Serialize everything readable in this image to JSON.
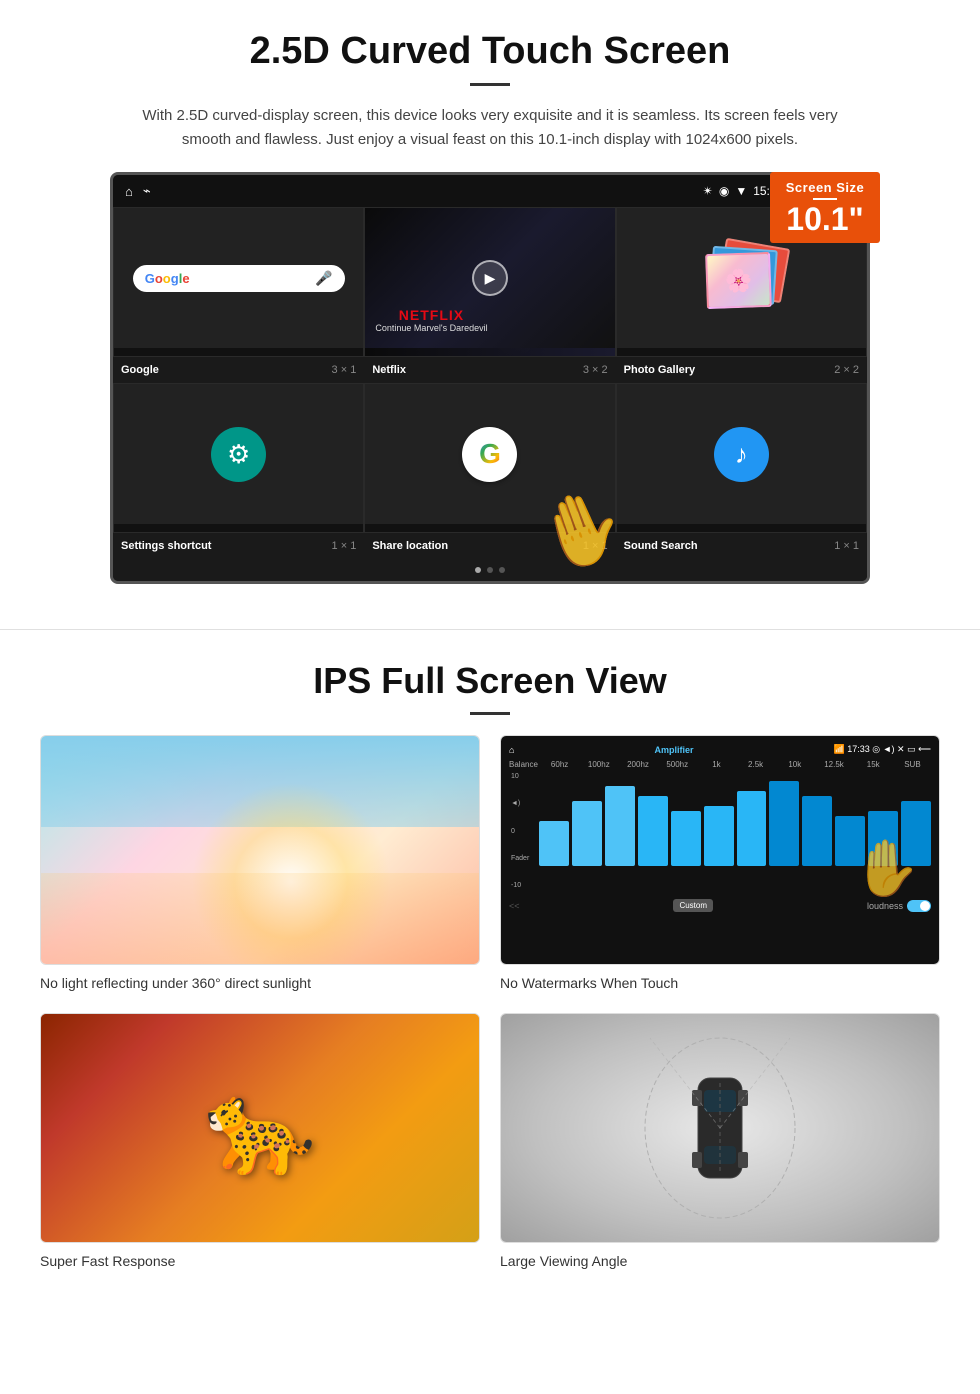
{
  "section1": {
    "title": "2.5D Curved Touch Screen",
    "description": "With 2.5D curved-display screen, this device looks very exquisite and it is seamless. Its screen feels very smooth and flawless. Just enjoy a visual feast on this 10.1-inch display with 1024x600 pixels.",
    "screen_size_badge": {
      "label": "Screen Size",
      "size": "10.1\""
    },
    "status_bar": {
      "time": "15:06"
    },
    "apps": [
      {
        "name": "Google",
        "size": "3 × 1",
        "type": "google"
      },
      {
        "name": "Netflix",
        "size": "3 × 2",
        "type": "netflix",
        "subtitle": "Continue Marvel's Daredevil"
      },
      {
        "name": "Photo Gallery",
        "size": "2 × 2",
        "type": "gallery"
      },
      {
        "name": "Settings shortcut",
        "size": "1 × 1",
        "type": "settings"
      },
      {
        "name": "Share location",
        "size": "1 × 1",
        "type": "share"
      },
      {
        "name": "Sound Search",
        "size": "1 × 1",
        "type": "sound"
      }
    ]
  },
  "section2": {
    "title": "IPS Full Screen View",
    "features": [
      {
        "id": "sunlight",
        "label": "No light reflecting under 360° direct sunlight",
        "image_type": "sky"
      },
      {
        "id": "watermark",
        "label": "No Watermarks When Touch",
        "image_type": "amplifier"
      },
      {
        "id": "response",
        "label": "Super Fast Response",
        "image_type": "cheetah"
      },
      {
        "id": "angle",
        "label": "Large Viewing Angle",
        "image_type": "car"
      }
    ]
  },
  "eq_bars": [
    45,
    65,
    80,
    70,
    55,
    60,
    75,
    85,
    70,
    50,
    55,
    65
  ],
  "icons": {
    "home": "⌂",
    "usb": "⌁",
    "bluetooth": "✴",
    "location": "◉",
    "wifi": "▼",
    "camera": "◎",
    "volume": "◄)",
    "close": "✕",
    "battery": "▭",
    "mic": "🎤",
    "play": "▶",
    "music": "♪",
    "settings_gear": "⚙"
  }
}
